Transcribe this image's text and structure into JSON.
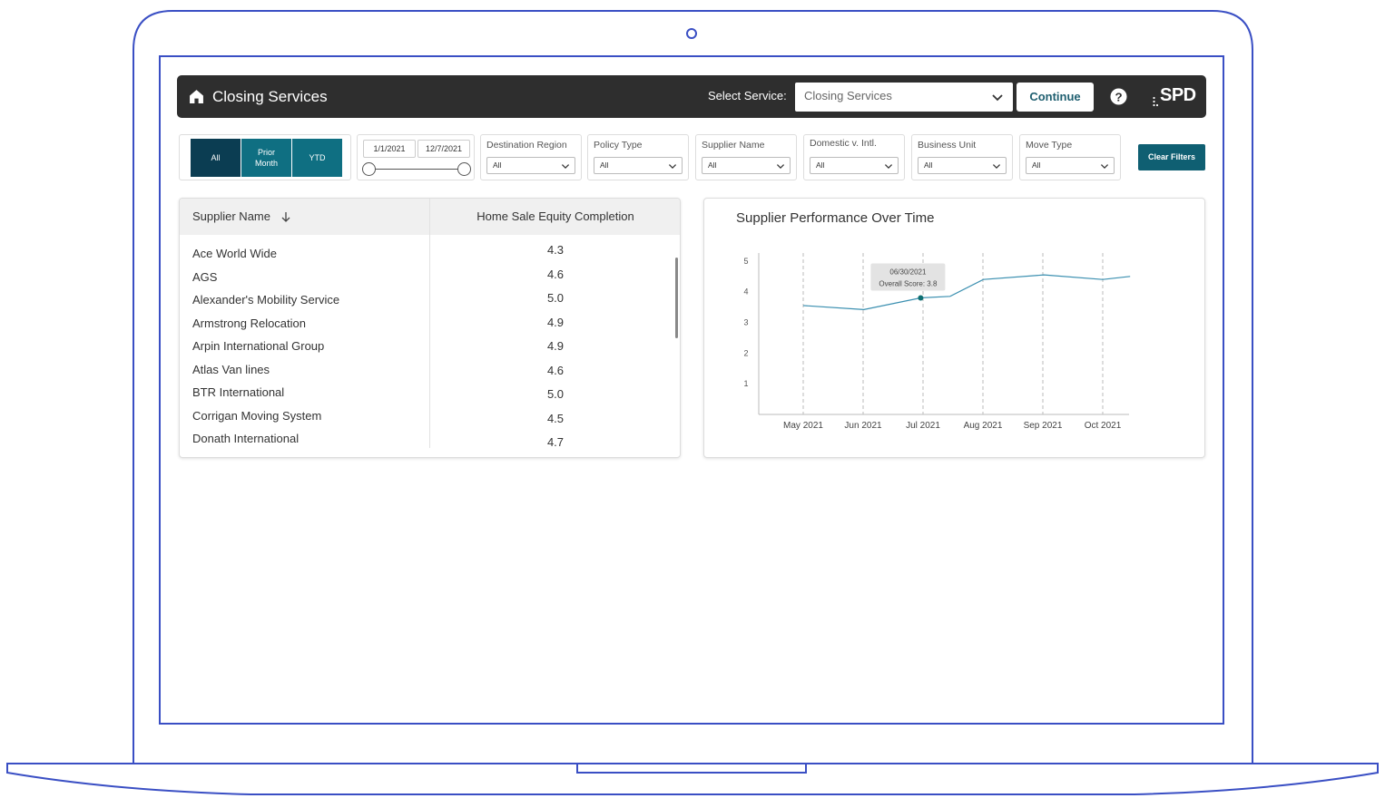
{
  "app": {
    "title": "Closing Services",
    "select_label": "Select Service:",
    "service_value": "Closing Services",
    "continue_label": "Continue",
    "brand": "SPD"
  },
  "filters": {
    "periods": [
      {
        "label": "All",
        "active": true
      },
      {
        "label": "Prior Month",
        "active": false
      },
      {
        "label": "YTD",
        "active": false
      }
    ],
    "date_start": "1/1/2021",
    "date_end": "12/7/2021",
    "dropdowns": [
      {
        "label": "Destination Region",
        "value": "All"
      },
      {
        "label": "Policy Type",
        "value": "All"
      },
      {
        "label": "Supplier Name",
        "value": "All"
      },
      {
        "label": "Domestic v. Intl.",
        "value": "All"
      },
      {
        "label": "Business Unit",
        "value": "All"
      },
      {
        "label": "Move Type",
        "value": "All"
      }
    ],
    "clear_label": "Clear Filters"
  },
  "table": {
    "col_supplier": "Supplier Name",
    "col_metric": "Home Sale Equity Completion",
    "rows": [
      {
        "name": "Ace World Wide",
        "value": "4.3"
      },
      {
        "name": "AGS",
        "value": "4.6"
      },
      {
        "name": "Alexander's Mobility Service",
        "value": "5.0"
      },
      {
        "name": "Armstrong Relocation",
        "value": "4.9"
      },
      {
        "name": "Arpin International Group",
        "value": "4.9"
      },
      {
        "name": "Atlas Van lines",
        "value": "4.6"
      },
      {
        "name": "BTR International",
        "value": "5.0"
      },
      {
        "name": "Corrigan Moving System",
        "value": "4.5"
      },
      {
        "name": "Donath International",
        "value": "4.7"
      }
    ]
  },
  "chart_data": {
    "type": "line",
    "title": "Supplier Performance Over Time",
    "x": [
      "2021-05-01",
      "2021-06-01",
      "2021-06-30",
      "2021-07-15",
      "2021-08-01",
      "2021-09-01",
      "2021-10-01",
      "2021-10-15"
    ],
    "xticks": [
      "May 2021",
      "Jun 2021",
      "Jul 2021",
      "Aug 2021",
      "Sep 2021",
      "Oct 2021"
    ],
    "yticks": [
      "1",
      "2",
      "3",
      "4",
      "5"
    ],
    "ylim": [
      0,
      5.5
    ],
    "series": [
      {
        "values": [
          3.55,
          3.42,
          3.8,
          3.85,
          4.4,
          4.55,
          4.4,
          4.5
        ],
        "color": "#3a8fb0"
      }
    ],
    "grid": "vertical dashed",
    "tooltip": {
      "date": "06/30/2021",
      "text": "Overall Score: 3.8"
    }
  },
  "colors": {
    "topbar": "#2e2e2e",
    "active_period": "#0b3d52",
    "period": "#0f6f82",
    "accent": "#0f5f72",
    "device_outline": "#3a4fc4"
  }
}
